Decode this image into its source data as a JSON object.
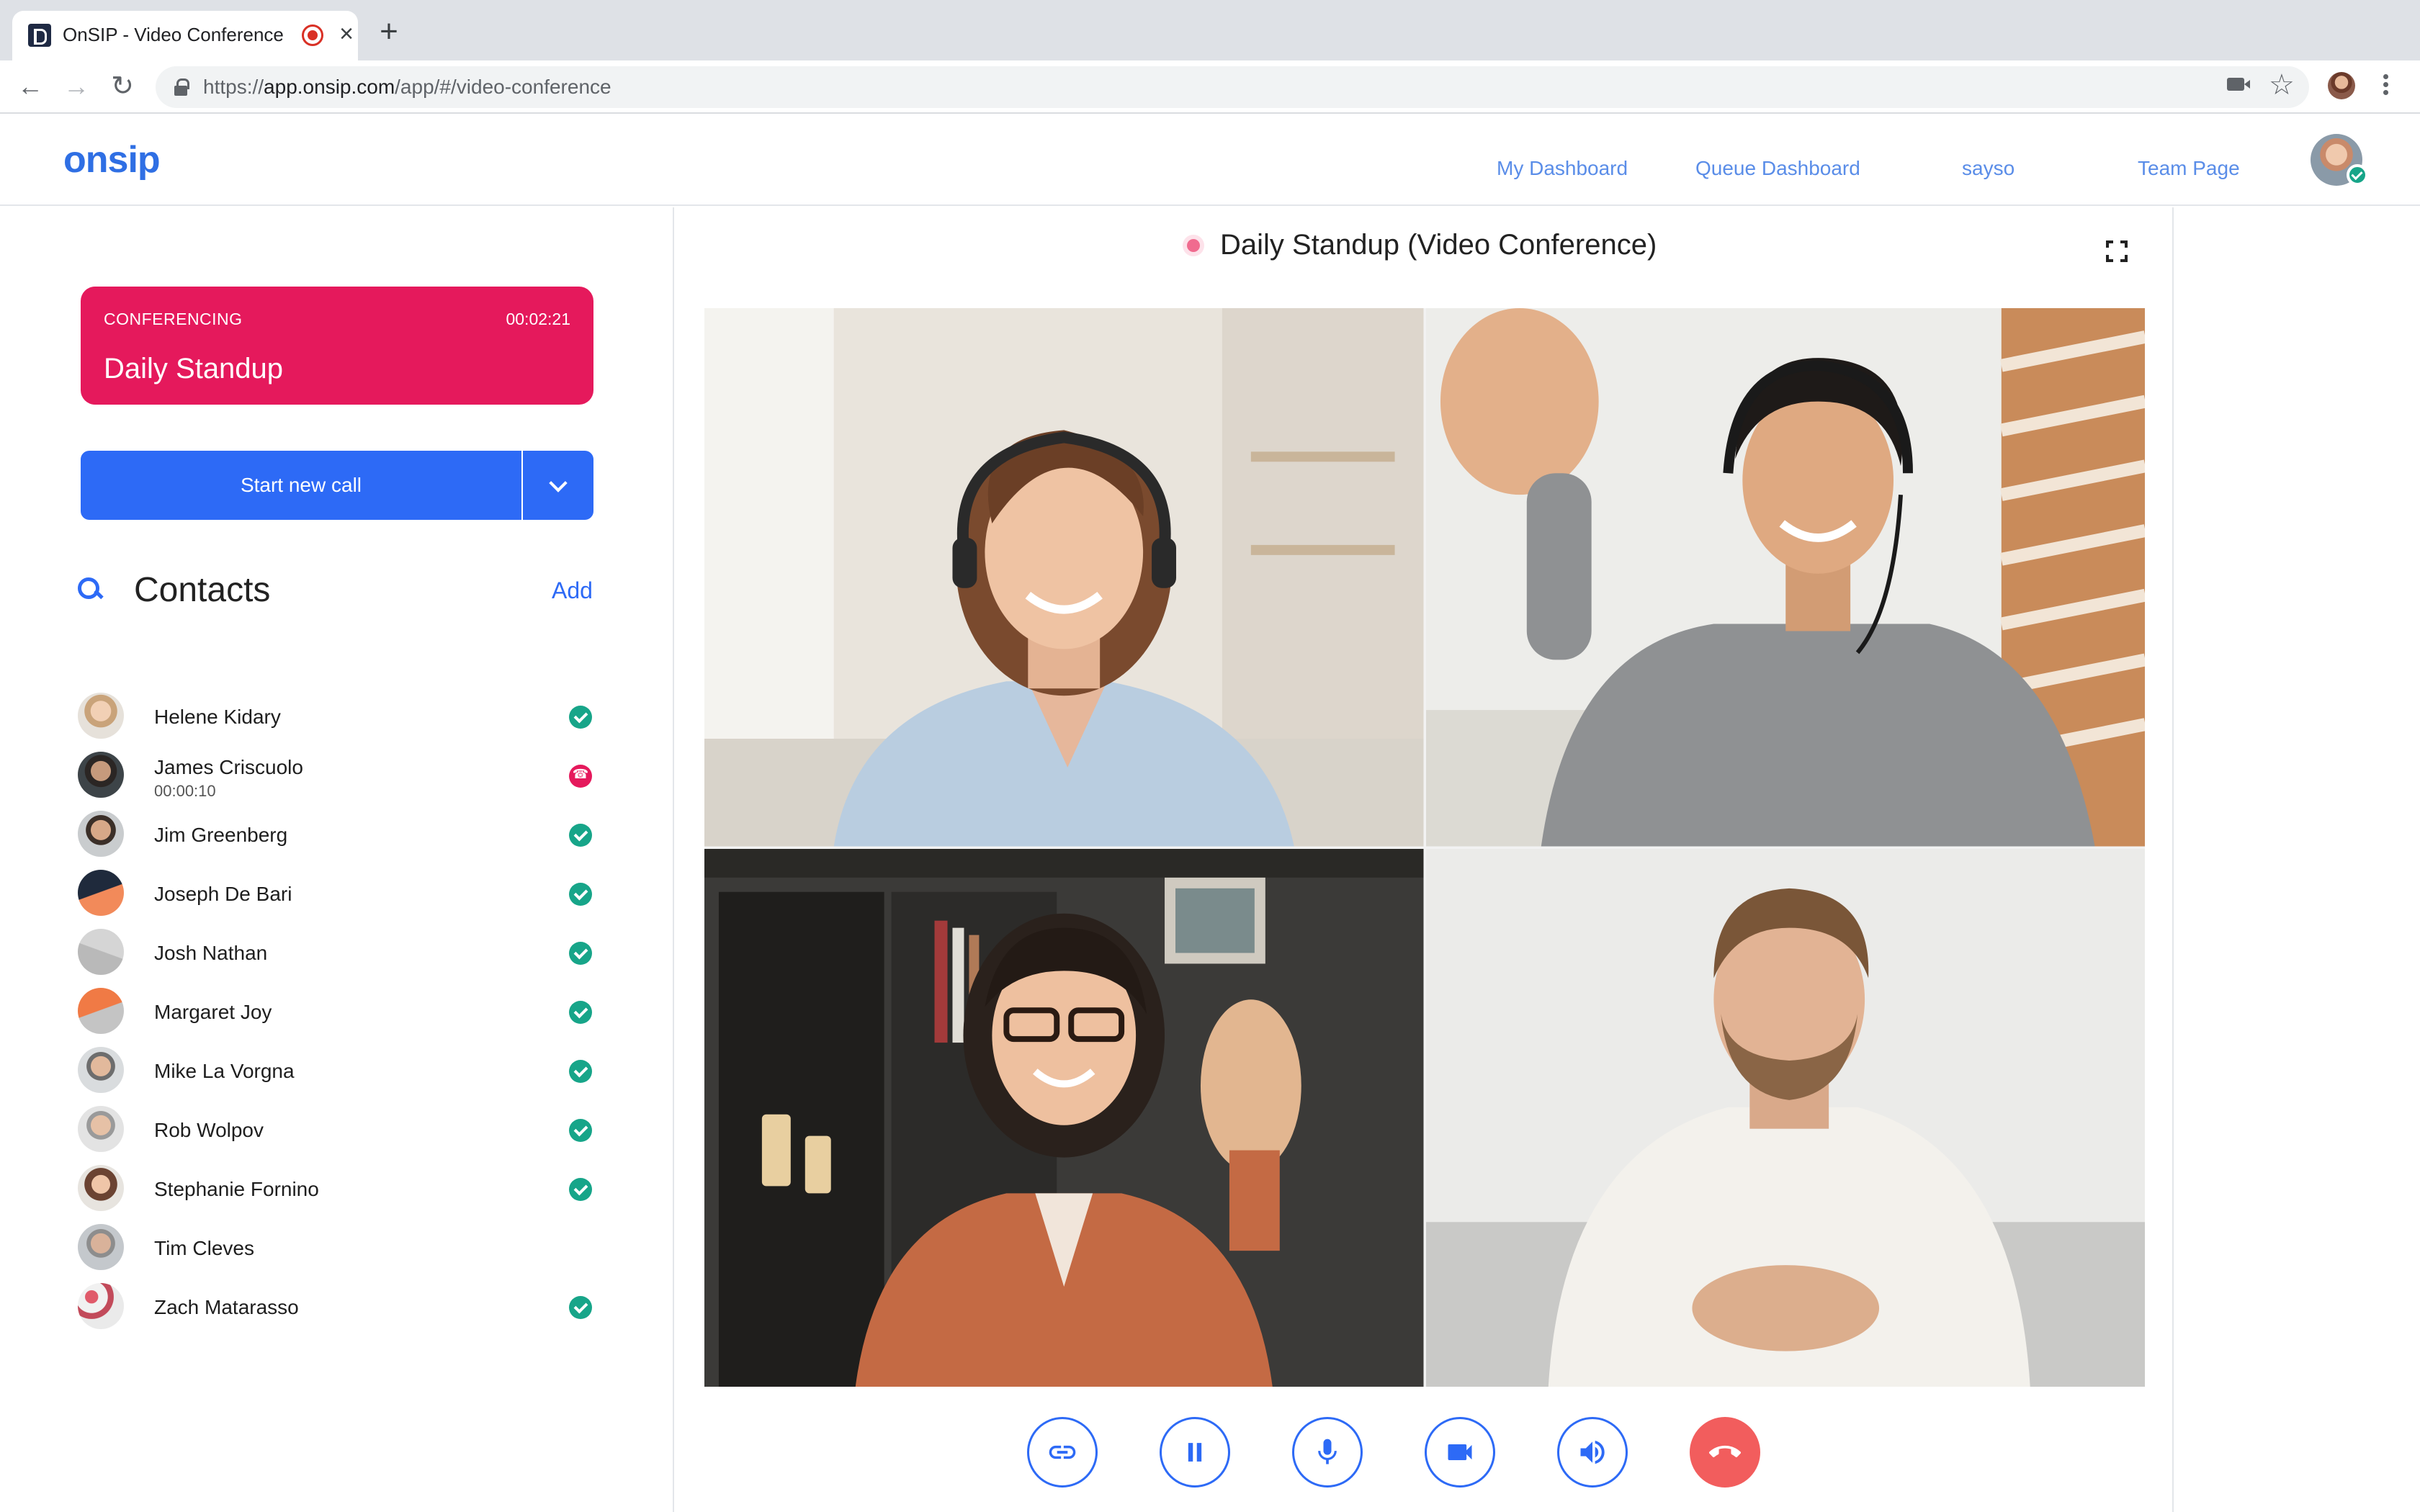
{
  "browser": {
    "tab_title": "OnSIP - Video Conference",
    "url_prefix": "https://",
    "url_host": "app.onsip.com",
    "url_path": "/app/#/video-conference"
  },
  "header": {
    "logo": "onsip",
    "nav": [
      "My Dashboard",
      "Queue Dashboard",
      "sayso",
      "Team Page"
    ]
  },
  "conference_card": {
    "status": "CONFERENCING",
    "timer": "00:02:21",
    "name": "Daily Standup",
    "color": "#e5195c"
  },
  "call_button": {
    "label": "Start new call",
    "color": "#2d6af6"
  },
  "contacts": {
    "title": "Contacts",
    "add_label": "Add",
    "items": [
      {
        "name": "Helene Kidary",
        "sub": "",
        "status": "available"
      },
      {
        "name": "James Criscuolo",
        "sub": "00:00:10",
        "status": "on-call"
      },
      {
        "name": "Jim Greenberg",
        "sub": "",
        "status": "available"
      },
      {
        "name": "Joseph De Bari",
        "sub": "",
        "status": "available"
      },
      {
        "name": "Josh Nathan",
        "sub": "",
        "status": "available"
      },
      {
        "name": "Margaret Joy",
        "sub": "",
        "status": "available"
      },
      {
        "name": "Mike La Vorgna",
        "sub": "",
        "status": "available"
      },
      {
        "name": "Rob Wolpov",
        "sub": "",
        "status": "available"
      },
      {
        "name": "Stephanie Fornino",
        "sub": "",
        "status": "available"
      },
      {
        "name": "Tim Cleves",
        "sub": "",
        "status": "offline"
      },
      {
        "name": "Zach Matarasso",
        "sub": "",
        "status": "available"
      }
    ]
  },
  "conference": {
    "title": "Daily Standup (Video Conference)",
    "participants": [
      "woman-headset-curly-hair",
      "man-headset-waving",
      "woman-glasses-waving",
      "man-beard-white-shirt"
    ],
    "controls": [
      "link-icon",
      "pause-icon",
      "microphone-icon",
      "video-camera-icon",
      "speaker-icon",
      "hang-up-icon"
    ]
  }
}
